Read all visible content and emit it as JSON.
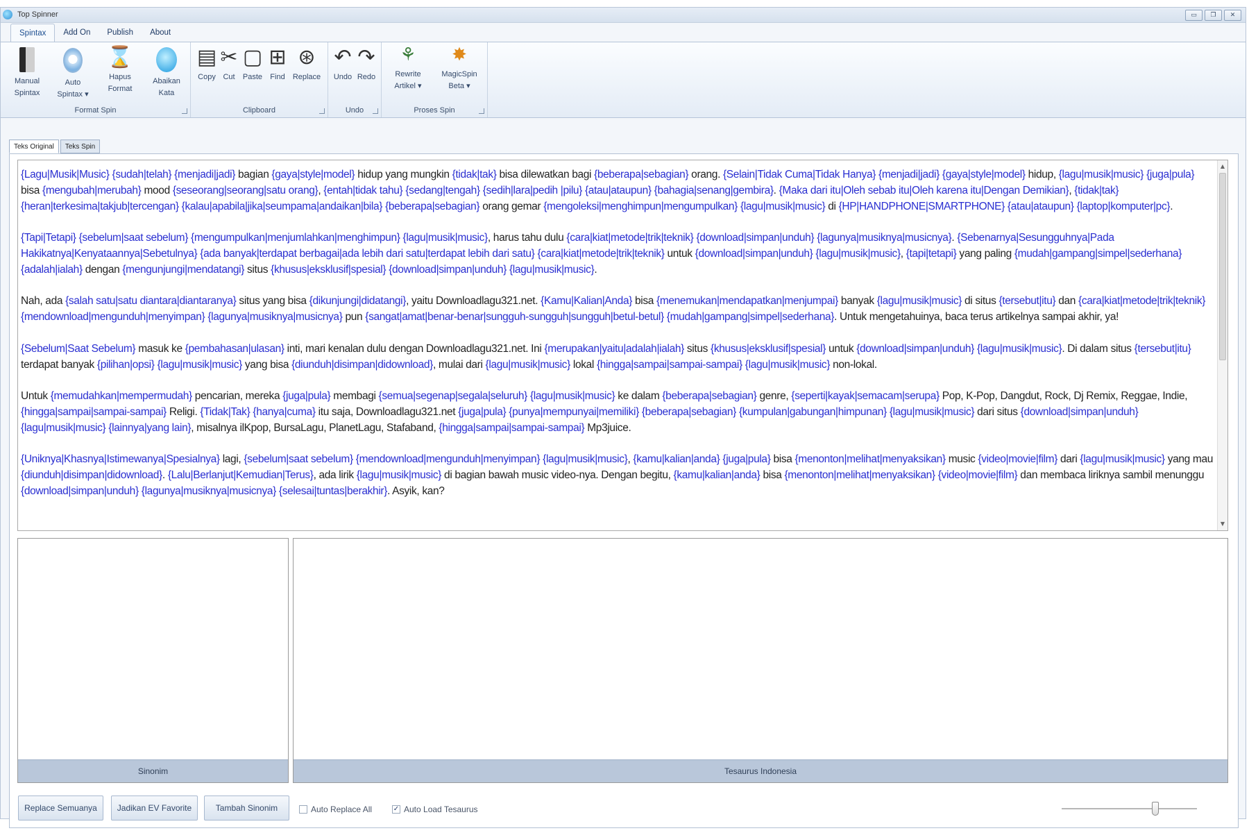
{
  "window": {
    "title": "Top Spinner",
    "controls": [
      "▭",
      "❐",
      "✕"
    ]
  },
  "menu": {
    "tabs": [
      "Spintax",
      "Add On",
      "Publish",
      "About"
    ],
    "active": "Spintax"
  },
  "ribbon": {
    "groups": {
      "format_spin": {
        "label": "Format Spin",
        "buttons": {
          "manual_spintax": [
            "Manual",
            "Spintax"
          ],
          "auto_spintax": [
            "Auto",
            "Spintax ▾"
          ],
          "hapus_format": [
            "Hapus",
            "Format"
          ],
          "abaikan_kata": [
            "Abaikan",
            "Kata"
          ]
        }
      },
      "clipboard": {
        "label": "Clipboard",
        "buttons": {
          "copy": "Copy",
          "cut": "Cut",
          "paste": "Paste",
          "find": "Find",
          "replace": "Replace"
        }
      },
      "undo": {
        "label": "Undo",
        "buttons": {
          "undo": "Undo",
          "redo": "Redo"
        }
      },
      "proses_spin": {
        "label": "Proses Spin",
        "buttons": {
          "rewrite_artikel": [
            "Rewrite",
            "Artikel ▾"
          ],
          "magicspin_beta": [
            "MagicSpin",
            "Beta ▾"
          ]
        }
      }
    }
  },
  "content_tabs": [
    "Teks Original",
    "Teks Spin"
  ],
  "editor": {
    "paragraphs": [
      [
        [
          "s",
          "{Lagu|Musik|Music}"
        ],
        [
          "t",
          " "
        ],
        [
          "s",
          "{sudah|telah}"
        ],
        [
          "t",
          " "
        ],
        [
          "s",
          "{menjadi|jadi}"
        ],
        [
          "t",
          " bagian "
        ],
        [
          "s",
          "{gaya|style|model}"
        ],
        [
          "t",
          " hidup yang mungkin "
        ],
        [
          "s",
          "{tidak|tak}"
        ],
        [
          "t",
          " bisa dilewatkan bagi "
        ],
        [
          "s",
          "{beberapa|sebagian}"
        ],
        [
          "t",
          " orang. "
        ],
        [
          "s",
          "{Selain|Tidak Cuma|Tidak Hanya}"
        ],
        [
          "t",
          " "
        ],
        [
          "s",
          "{menjadi|jadi}"
        ],
        [
          "t",
          " "
        ],
        [
          "s",
          "{gaya|style|model}"
        ],
        [
          "t",
          " hidup, "
        ],
        [
          "s",
          "{lagu|musik|music}"
        ],
        [
          "t",
          " "
        ],
        [
          "s",
          "{juga|pula}"
        ],
        [
          "t",
          " bisa "
        ],
        [
          "s",
          "{mengubah|merubah}"
        ],
        [
          "t",
          " mood "
        ],
        [
          "s",
          "{seseorang|seorang|satu orang}"
        ],
        [
          "t",
          ", "
        ],
        [
          "s",
          "{entah|tidak tahu}"
        ],
        [
          "t",
          " "
        ],
        [
          "s",
          "{sedang|tengah}"
        ],
        [
          "t",
          " "
        ],
        [
          "s",
          "{sedih|lara|pedih      |pilu}"
        ],
        [
          "t",
          " "
        ],
        [
          "s",
          "{atau|ataupun}"
        ],
        [
          "t",
          " "
        ],
        [
          "s",
          "{bahagia|senang|gembira}"
        ],
        [
          "t",
          ". "
        ],
        [
          "s",
          "{Maka dari itu|Oleh sebab itu|Oleh karena itu|Dengan Demikian}"
        ],
        [
          "t",
          ", "
        ],
        [
          "s",
          "{tidak|tak}"
        ],
        [
          "t",
          " "
        ],
        [
          "s",
          "{heran|terkesima|takjub|tercengan}"
        ],
        [
          "t",
          " "
        ],
        [
          "s",
          "{kalau|apabila|jika|seumpama|andaikan|bila}"
        ],
        [
          "t",
          " "
        ],
        [
          "s",
          "{beberapa|sebagian}"
        ],
        [
          "t",
          " orang gemar "
        ],
        [
          "s",
          "{mengoleksi|menghimpun|mengumpulkan}"
        ],
        [
          "t",
          " "
        ],
        [
          "s",
          "{lagu|musik|music}"
        ],
        [
          "t",
          " di "
        ],
        [
          "s",
          "{HP|HANDPHONE|SMARTPHONE}"
        ],
        [
          "t",
          " "
        ],
        [
          "s",
          "{atau|ataupun}"
        ],
        [
          "t",
          " "
        ],
        [
          "s",
          "{laptop|komputer|pc}"
        ],
        [
          "t",
          "."
        ]
      ],
      [
        [
          "s",
          "{Tapi|Tetapi}"
        ],
        [
          "t",
          " "
        ],
        [
          "s",
          "{sebelum|saat sebelum}"
        ],
        [
          "t",
          " "
        ],
        [
          "s",
          "{mengumpulkan|menjumlahkan|menghimpun}"
        ],
        [
          "t",
          " "
        ],
        [
          "s",
          "{lagu|musik|music}"
        ],
        [
          "t",
          ", harus tahu dulu "
        ],
        [
          "s",
          "{cara|kiat|metode|trik|teknik}"
        ],
        [
          "t",
          " "
        ],
        [
          "s",
          "{download|simpan|unduh}"
        ],
        [
          "t",
          " "
        ],
        [
          "s",
          "{lagunya|musiknya|musicnya}"
        ],
        [
          "t",
          ". "
        ],
        [
          "s",
          "{Sebenarnya|Sesungguhnya|Pada Hakikatnya|Kenyataannya|Sebetulnya}"
        ],
        [
          "t",
          " "
        ],
        [
          "s",
          "{ada banyak|terdapat berbagai|ada lebih dari satu|terdapat lebih dari satu}"
        ],
        [
          "t",
          " "
        ],
        [
          "s",
          "{cara|kiat|metode|trik|teknik}"
        ],
        [
          "t",
          " untuk "
        ],
        [
          "s",
          "{download|simpan|unduh}"
        ],
        [
          "t",
          " "
        ],
        [
          "s",
          "{lagu|musik|music}"
        ],
        [
          "t",
          ", "
        ],
        [
          "s",
          "{tapi|tetapi}"
        ],
        [
          "t",
          " yang paling "
        ],
        [
          "s",
          "{mudah|gampang|simpel|sederhana}"
        ],
        [
          "t",
          " "
        ],
        [
          "s",
          "{adalah|ialah}"
        ],
        [
          "t",
          " dengan "
        ],
        [
          "s",
          "{mengunjungi|mendatangi}"
        ],
        [
          "t",
          " situs "
        ],
        [
          "s",
          "{khusus|eksklusif|spesial}"
        ],
        [
          "t",
          " "
        ],
        [
          "s",
          "{download|simpan|unduh}"
        ],
        [
          "t",
          " "
        ],
        [
          "s",
          "{lagu|musik|music}"
        ],
        [
          "t",
          "."
        ]
      ],
      [
        [
          "t",
          "Nah, ada "
        ],
        [
          "s",
          "{salah satu|satu diantara|diantaranya}"
        ],
        [
          "t",
          " situs yang bisa "
        ],
        [
          "s",
          "{dikunjungi|didatangi}"
        ],
        [
          "t",
          ", yaitu Downloadlagu321.net. "
        ],
        [
          "s",
          "{Kamu|Kalian|Anda}"
        ],
        [
          "t",
          " bisa "
        ],
        [
          "s",
          "{menemukan|mendapatkan|menjumpai}"
        ],
        [
          "t",
          " banyak "
        ],
        [
          "s",
          "{lagu|musik|music}"
        ],
        [
          "t",
          " di situs "
        ],
        [
          "s",
          "{tersebut|itu}"
        ],
        [
          "t",
          " dan "
        ],
        [
          "s",
          "{cara|kiat|metode|trik|teknik}"
        ],
        [
          "t",
          " "
        ],
        [
          "s",
          "{mendownload|mengunduh|menyimpan}"
        ],
        [
          "t",
          " "
        ],
        [
          "s",
          "{lagunya|musiknya|musicnya}"
        ],
        [
          "t",
          " pun "
        ],
        [
          "s",
          "{sangat|amat|benar-benar|sungguh-sungguh|sungguh|betul-betul}"
        ],
        [
          "t",
          " "
        ],
        [
          "s",
          "{mudah|gampang|simpel|sederhana}"
        ],
        [
          "t",
          ". Untuk mengetahuinya, baca terus artikelnya sampai akhir, ya!"
        ]
      ],
      [
        [
          "s",
          "{Sebelum|Saat Sebelum}"
        ],
        [
          "t",
          " masuk ke "
        ],
        [
          "s",
          "{pembahasan|ulasan}"
        ],
        [
          "t",
          " inti, mari kenalan dulu dengan Downloadlagu321.net. Ini "
        ],
        [
          "s",
          "{merupakan|yaitu|adalah|ialah}"
        ],
        [
          "t",
          " situs "
        ],
        [
          "s",
          "{khusus|eksklusif|spesial}"
        ],
        [
          "t",
          " untuk "
        ],
        [
          "s",
          "{download|simpan|unduh}"
        ],
        [
          "t",
          " "
        ],
        [
          "s",
          "{lagu|musik|music}"
        ],
        [
          "t",
          ". Di dalam situs "
        ],
        [
          "s",
          "{tersebut|itu}"
        ],
        [
          "t",
          " terdapat banyak "
        ],
        [
          "s",
          "{pilihan|opsi}"
        ],
        [
          "t",
          " "
        ],
        [
          "s",
          "{lagu|musik|music}"
        ],
        [
          "t",
          " yang bisa "
        ],
        [
          "s",
          "{diunduh|disimpan|didownload}"
        ],
        [
          "t",
          ", mulai dari "
        ],
        [
          "s",
          "{lagu|musik|music}"
        ],
        [
          "t",
          " lokal "
        ],
        [
          "s",
          "{hingga|sampai|sampai-sampai}"
        ],
        [
          "t",
          " "
        ],
        [
          "s",
          "{lagu|musik|music}"
        ],
        [
          "t",
          " non-lokal."
        ]
      ],
      [
        [
          "t",
          "Untuk "
        ],
        [
          "s",
          "{memudahkan|mempermudah}"
        ],
        [
          "t",
          " pencarian, mereka "
        ],
        [
          "s",
          "{juga|pula}"
        ],
        [
          "t",
          " membagi "
        ],
        [
          "s",
          "{semua|segenap|segala|seluruh}"
        ],
        [
          "t",
          " "
        ],
        [
          "s",
          "{lagu|musik|music}"
        ],
        [
          "t",
          " ke dalam "
        ],
        [
          "s",
          "{beberapa|sebagian}"
        ],
        [
          "t",
          " genre, "
        ],
        [
          "s",
          "{seperti|kayak|semacam|serupa}"
        ],
        [
          "t",
          " Pop, K-Pop, Dangdut, Rock, Dj Remix, Reggae, Indie, "
        ],
        [
          "s",
          "{hingga|sampai|sampai-sampai}"
        ],
        [
          "t",
          " Religi. "
        ],
        [
          "s",
          "{Tidak|Tak}"
        ],
        [
          "t",
          " "
        ],
        [
          "s",
          "{hanya|cuma}"
        ],
        [
          "t",
          " itu saja, Downloadlagu321.net "
        ],
        [
          "s",
          "{juga|pula}"
        ],
        [
          "t",
          " "
        ],
        [
          "s",
          "{punya|mempunyai|memiliki}"
        ],
        [
          "t",
          " "
        ],
        [
          "s",
          "{beberapa|sebagian}"
        ],
        [
          "t",
          " "
        ],
        [
          "s",
          "{kumpulan|gabungan|himpunan}"
        ],
        [
          "t",
          " "
        ],
        [
          "s",
          "{lagu|musik|music}"
        ],
        [
          "t",
          " dari situs "
        ],
        [
          "s",
          "{download|simpan|unduh}"
        ],
        [
          "t",
          " "
        ],
        [
          "s",
          "{lagu|musik|music}"
        ],
        [
          "t",
          " "
        ],
        [
          "s",
          "{lainnya|yang lain}"
        ],
        [
          "t",
          ", misalnya ilKpop, BursaLagu, PlanetLagu, Stafaband, "
        ],
        [
          "s",
          "{hingga|sampai|sampai-sampai}"
        ],
        [
          "t",
          " Mp3juice."
        ]
      ],
      [
        [
          "s",
          "{Uniknya|Khasnya|Istimewanya|Spesialnya}"
        ],
        [
          "t",
          " lagi, "
        ],
        [
          "s",
          "{sebelum|saat sebelum}"
        ],
        [
          "t",
          " "
        ],
        [
          "s",
          "{mendownload|mengunduh|menyimpan}"
        ],
        [
          "t",
          " "
        ],
        [
          "s",
          "{lagu|musik|music}"
        ],
        [
          "t",
          ", "
        ],
        [
          "s",
          "{kamu|kalian|anda}"
        ],
        [
          "t",
          " "
        ],
        [
          "s",
          "{juga|pula}"
        ],
        [
          "t",
          " bisa "
        ],
        [
          "s",
          "{menonton|melihat|menyaksikan}"
        ],
        [
          "t",
          " music "
        ],
        [
          "s",
          "{video|movie|film}"
        ],
        [
          "t",
          " dari "
        ],
        [
          "s",
          "{lagu|musik|music}"
        ],
        [
          "t",
          " yang mau "
        ],
        [
          "s",
          "{diunduh|disimpan|didownload}"
        ],
        [
          "t",
          ". "
        ],
        [
          "s",
          "{Lalu|Berlanjut|Kemudian|Terus}"
        ],
        [
          "t",
          ", ada lirik "
        ],
        [
          "s",
          "{lagu|musik|music}"
        ],
        [
          "t",
          " di bagian bawah music video-nya. Dengan begitu, "
        ],
        [
          "s",
          "{kamu|kalian|anda}"
        ],
        [
          "t",
          " bisa "
        ],
        [
          "s",
          "{menonton|melihat|menyaksikan}"
        ],
        [
          "t",
          " "
        ],
        [
          "s",
          "{video|movie|film}"
        ],
        [
          "t",
          " dan membaca liriknya sambil menunggu "
        ],
        [
          "s",
          "{download|simpan|unduh}"
        ],
        [
          "t",
          " "
        ],
        [
          "s",
          "{lagunya|musiknya|musicnya}"
        ],
        [
          "t",
          " "
        ],
        [
          "s",
          "{selesai|tuntas|berakhir}"
        ],
        [
          "t",
          ". Asyik, kan?"
        ]
      ]
    ]
  },
  "panels": {
    "sinonim": {
      "label": "Sinonim"
    },
    "tesaurus": {
      "label": "Tesaurus Indonesia"
    }
  },
  "actions": {
    "replace_semuanya": "Replace Semuanya",
    "jadikan_ev_favorite": "Jadikan EV Favorite",
    "tambah_sinonim": "Tambah Sinonim"
  },
  "options": {
    "auto_replace_all": {
      "label": "Auto Replace All",
      "checked": false
    },
    "auto_load_tesaurus": {
      "label": "Auto Load Tesaurus",
      "checked": true
    }
  },
  "slider": {
    "value": 0.7
  },
  "colors": {
    "spintax": "#2a2fd1",
    "accent": "#1d4f91"
  }
}
